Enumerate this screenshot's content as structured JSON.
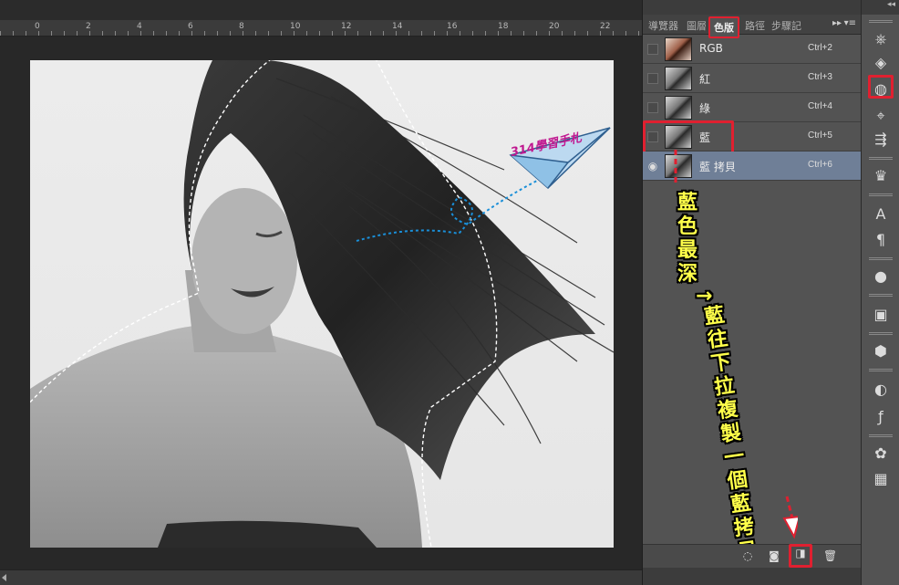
{
  "ruler": {
    "labels": [
      "0",
      "2",
      "4",
      "6",
      "8",
      "10",
      "12",
      "14",
      "16",
      "18",
      "20",
      "22"
    ]
  },
  "panel": {
    "tabs": [
      {
        "label": "導覽器",
        "active": false
      },
      {
        "label": "圖層",
        "active": false
      },
      {
        "label": "色版",
        "active": true
      },
      {
        "label": "路徑",
        "active": false
      },
      {
        "label": "步驟記",
        "active": false
      }
    ],
    "collapse_label": "▸▸",
    "menu_label": "▾≡",
    "channels": [
      {
        "name": "RGB",
        "shortcut": "Ctrl+2",
        "visible": false,
        "selected": false,
        "thumb": "rgb"
      },
      {
        "name": "紅",
        "shortcut": "Ctrl+3",
        "visible": false,
        "selected": false,
        "thumb": "gray"
      },
      {
        "name": "綠",
        "shortcut": "Ctrl+4",
        "visible": false,
        "selected": false,
        "thumb": "gray"
      },
      {
        "name": "藍",
        "shortcut": "Ctrl+5",
        "visible": false,
        "selected": false,
        "thumb": "gray"
      },
      {
        "name": "藍 拷貝",
        "shortcut": "Ctrl+6",
        "visible": true,
        "selected": true,
        "thumb": "gray"
      }
    ]
  },
  "annotation": {
    "line1": "藍色最深",
    "arrow": "→",
    "line2": "藍往下拉複製一個藍拷貝",
    "color": "#ffff4a",
    "box_color": "#e02030"
  },
  "logo": {
    "text": "314學習手札",
    "color": "#c01890"
  },
  "toolbar": {
    "collapse_label": "◂◂",
    "tools": [
      "wheel-icon",
      "layers-icon",
      "channels-icon",
      "path-icon",
      "history-icon",
      "crown-icon",
      "character-icon",
      "paragraph-icon",
      "kuler-icon",
      "image-icon",
      "3d-icon",
      "adjustment-icon",
      "fx-icon",
      "swatches-icon",
      "grid-icon"
    ]
  }
}
